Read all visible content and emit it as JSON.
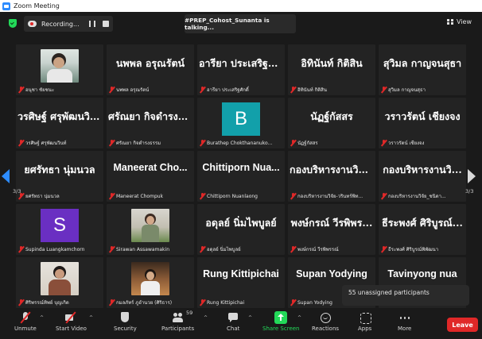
{
  "window": {
    "title": "Zoom Meeting"
  },
  "topbar": {
    "recording_label": "Recording...",
    "talking_banner": "#PREP_Cohost_Sunanta is talking...",
    "view_label": "View"
  },
  "pagination": {
    "left": "3/3",
    "right": "3/3"
  },
  "tiles": [
    {
      "big": "",
      "label": "อนุชา ชัยชนะ"
    },
    {
      "big": "นพพล อรุณรัตน์",
      "label": "นพพล อรุณรัตน์"
    },
    {
      "big": "อารียา ประเสริฐสั...",
      "label": "อารียา ประเสริฐศักดิ์"
    },
    {
      "big": "อิทินันท์ กิติสิน",
      "label": "อิทินันท์ กิติสิน"
    },
    {
      "big": "สุวิมล กาญจนสุธา",
      "label": "สุวิมล กาญจนสุธา"
    },
    {
      "big": "วรศิษฐ์ ศรุพัฒนวินท์",
      "label": "วรศิษฐ์ ศรุพัฒนวินท์"
    },
    {
      "big": "ศรัณยา กิจดำรงธ...",
      "label": "ศรัณยา กิจดำรงธรรม"
    },
    {
      "big": "",
      "avatar": "B",
      "label": "Burathep Chokthananuko..."
    },
    {
      "big": "นัฏฐ์กัสสร",
      "label": "นัฏฐ์กัสสร"
    },
    {
      "big": "วราวรัตน์ เชียงจง",
      "label": "วราวรัตน์ เชียงจง"
    },
    {
      "big": "ยศรัทธา นุ่มนวล",
      "label": "ยศรัทธา นุ่มนวล"
    },
    {
      "big": "Maneerat Cho...",
      "label": "Maneerat Chompuk"
    },
    {
      "big": "Chittiporn Nua...",
      "label": "Chittiporn Nuanlaong"
    },
    {
      "big": "กองบริหารงานวิจั...",
      "label": "กองบริหารงานวิจัย-วรินทร์พิท..."
    },
    {
      "big": "กองบริหารงานวิ...",
      "label": "กองบริหารงานวิจัย_ชนิดา..."
    },
    {
      "big": "",
      "avatar": "S",
      "label": "Supinda Luangkamchorn"
    },
    {
      "big": "",
      "label": "Sirawan Assawamakin"
    },
    {
      "big": "อดุลย์ นิ่มไพบูลย์",
      "label": "อดุลย์ นิ่มไพบูลย์"
    },
    {
      "big": "พงษ์กรณ์ วีรพิพร...",
      "label": "พงษ์กรณ์ วีรพิพรรณ์"
    },
    {
      "big": "ธีระพงศ์ ศิริบูรณ์...",
      "label": "ธีระพงศ์ ศิริบูรณ์พิพัฒนา"
    },
    {
      "big": "",
      "label": "ศิริพรรณ์ทิพย์ บุญเกิด"
    },
    {
      "big": "",
      "label": "กมลภัทร์ ภูอำนวย (ศิริธาร)"
    },
    {
      "big": "Rung Kittipichai",
      "label": "Rung Kittipichai"
    },
    {
      "big": "Supan Yodying",
      "label": "Supan Yodying"
    },
    {
      "big": "Tavinyong nua",
      "label": ""
    }
  ],
  "tooltip": {
    "text": "55 unassigned participants"
  },
  "toolbar": {
    "unmute": "Unmute",
    "start_video": "Start Video",
    "security": "Security",
    "participants": "Participants",
    "participants_count": "59",
    "chat": "Chat",
    "share_screen": "Share Screen",
    "reactions": "Reactions",
    "apps": "Apps",
    "more": "More",
    "leave": "Leave"
  },
  "colors": {
    "accent": "#2d8cff",
    "leave": "#e02828",
    "share": "#23d959",
    "avatar_b": "#12a0aa",
    "avatar_s": "#6a2fc2"
  }
}
